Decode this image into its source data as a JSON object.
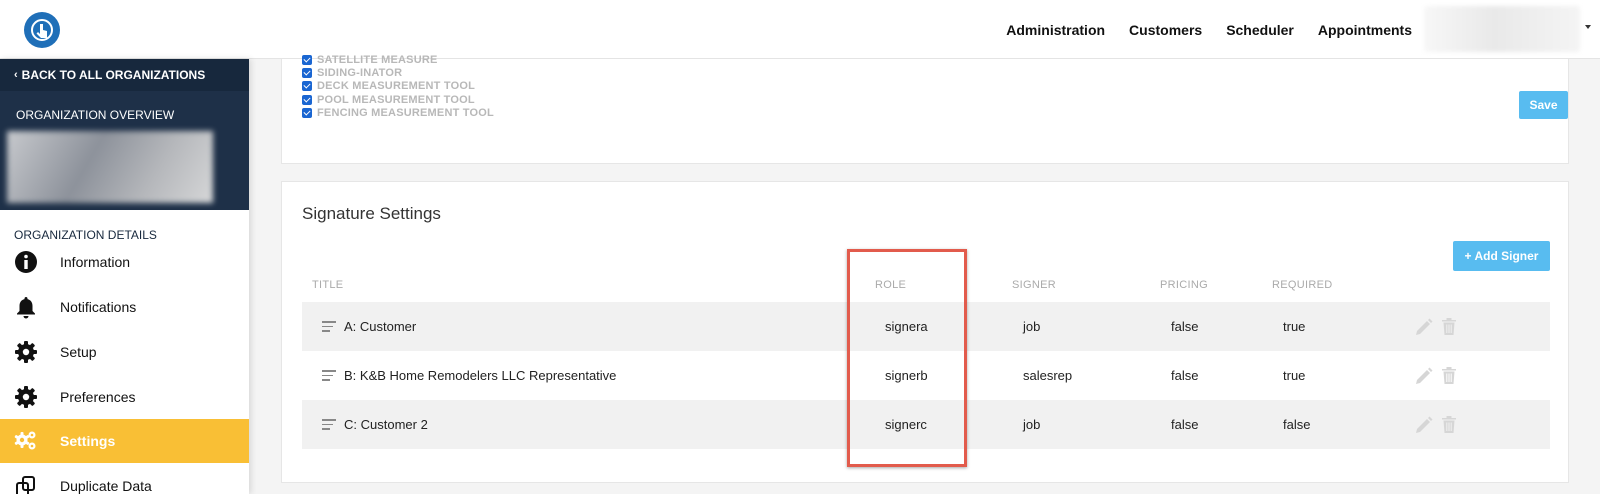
{
  "topnav": [
    "Administration",
    "Customers",
    "Scheduler",
    "Appointments"
  ],
  "sidebar": {
    "back_label": "BACK TO ALL ORGANIZATIONS",
    "overview_label": "ORGANIZATION OVERVIEW",
    "details_label": "ORGANIZATION DETAILS",
    "items": [
      {
        "label": "Information",
        "icon": "info-icon"
      },
      {
        "label": "Notifications",
        "icon": "bell-icon"
      },
      {
        "label": "Setup",
        "icon": "gear-icon"
      },
      {
        "label": "Preferences",
        "icon": "gear-icon"
      },
      {
        "label": "Settings",
        "icon": "gears-icon",
        "active": true
      },
      {
        "label": "Duplicate Data",
        "icon": "duplicate-icon"
      }
    ]
  },
  "tools": [
    {
      "label": "SATELLITE MEASURE",
      "checked": true
    },
    {
      "label": "SIDING-INATOR",
      "checked": true
    },
    {
      "label": "DECK MEASUREMENT TOOL",
      "checked": true
    },
    {
      "label": "POOL MEASUREMENT TOOL",
      "checked": true
    },
    {
      "label": "FENCING MEASUREMENT TOOL",
      "checked": true
    }
  ],
  "save_label": "Save",
  "signature": {
    "title": "Signature Settings",
    "add_label": "+ Add Signer",
    "columns": [
      "TITLE",
      "ROLE",
      "SIGNER",
      "PRICING",
      "REQUIRED"
    ],
    "rows": [
      {
        "title": "A: Customer",
        "role": "signera",
        "signer": "job",
        "pricing": "false",
        "required": "true"
      },
      {
        "title": "B: K&B Home Remodelers LLC Representative",
        "role": "signerb",
        "signer": "salesrep",
        "pricing": "false",
        "required": "true"
      },
      {
        "title": "C: Customer 2",
        "role": "signerc",
        "signer": "job",
        "pricing": "false",
        "required": "false"
      }
    ]
  },
  "colors": {
    "accent": "#f9bf35",
    "button": "#58bcf0",
    "sidebar_dark": "#1e3048",
    "highlight": "#e25b4c"
  }
}
